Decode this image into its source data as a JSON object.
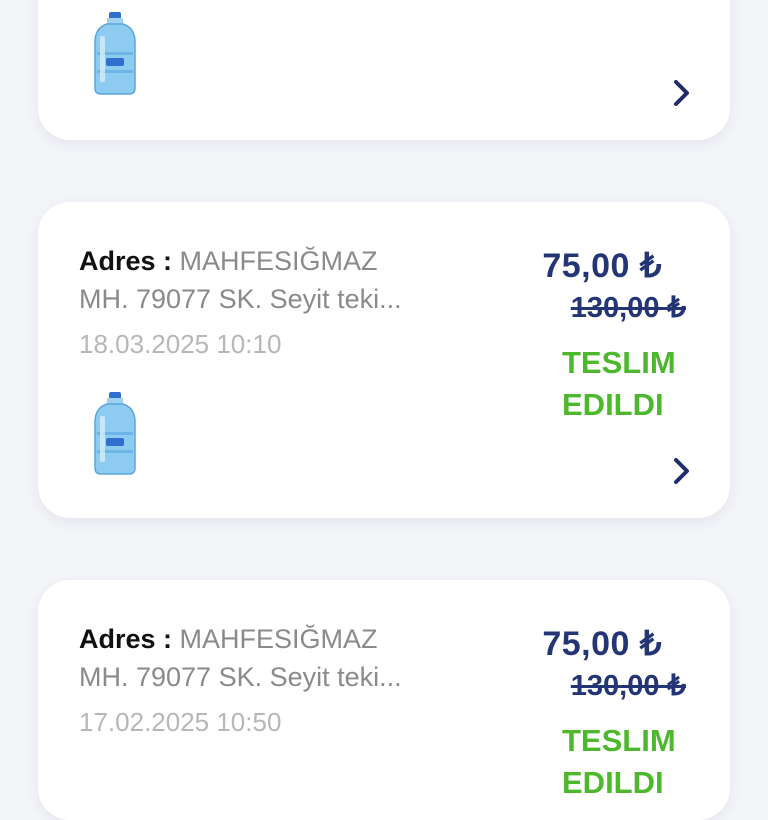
{
  "orders": [
    {},
    {
      "address_label": "Adres :",
      "address_line1": "MAHFESIĞMAZ",
      "address_line2": "MH.  79077 SK. Seyit teki...",
      "date": "18.03.2025 10:10",
      "price": "75,00 ₺",
      "old_price": "130,00 ₺",
      "status_line1": "TESLIM",
      "status_line2": "EDILDI"
    },
    {
      "address_label": "Adres :",
      "address_line1": "MAHFESIĞMAZ",
      "address_line2": "MH.  79077 SK. Seyit teki...",
      "date": "17.02.2025 10:50",
      "price": "75,00 ₺",
      "old_price": "130,00 ₺",
      "status_line1": "TESLIM",
      "status_line2": "EDILDI"
    }
  ],
  "colors": {
    "price": "#233575",
    "status_delivered": "#4db82c",
    "chevron": "#1f2d6b"
  },
  "icons": [
    "water-bottle-icon",
    "chevron-right-icon"
  ]
}
